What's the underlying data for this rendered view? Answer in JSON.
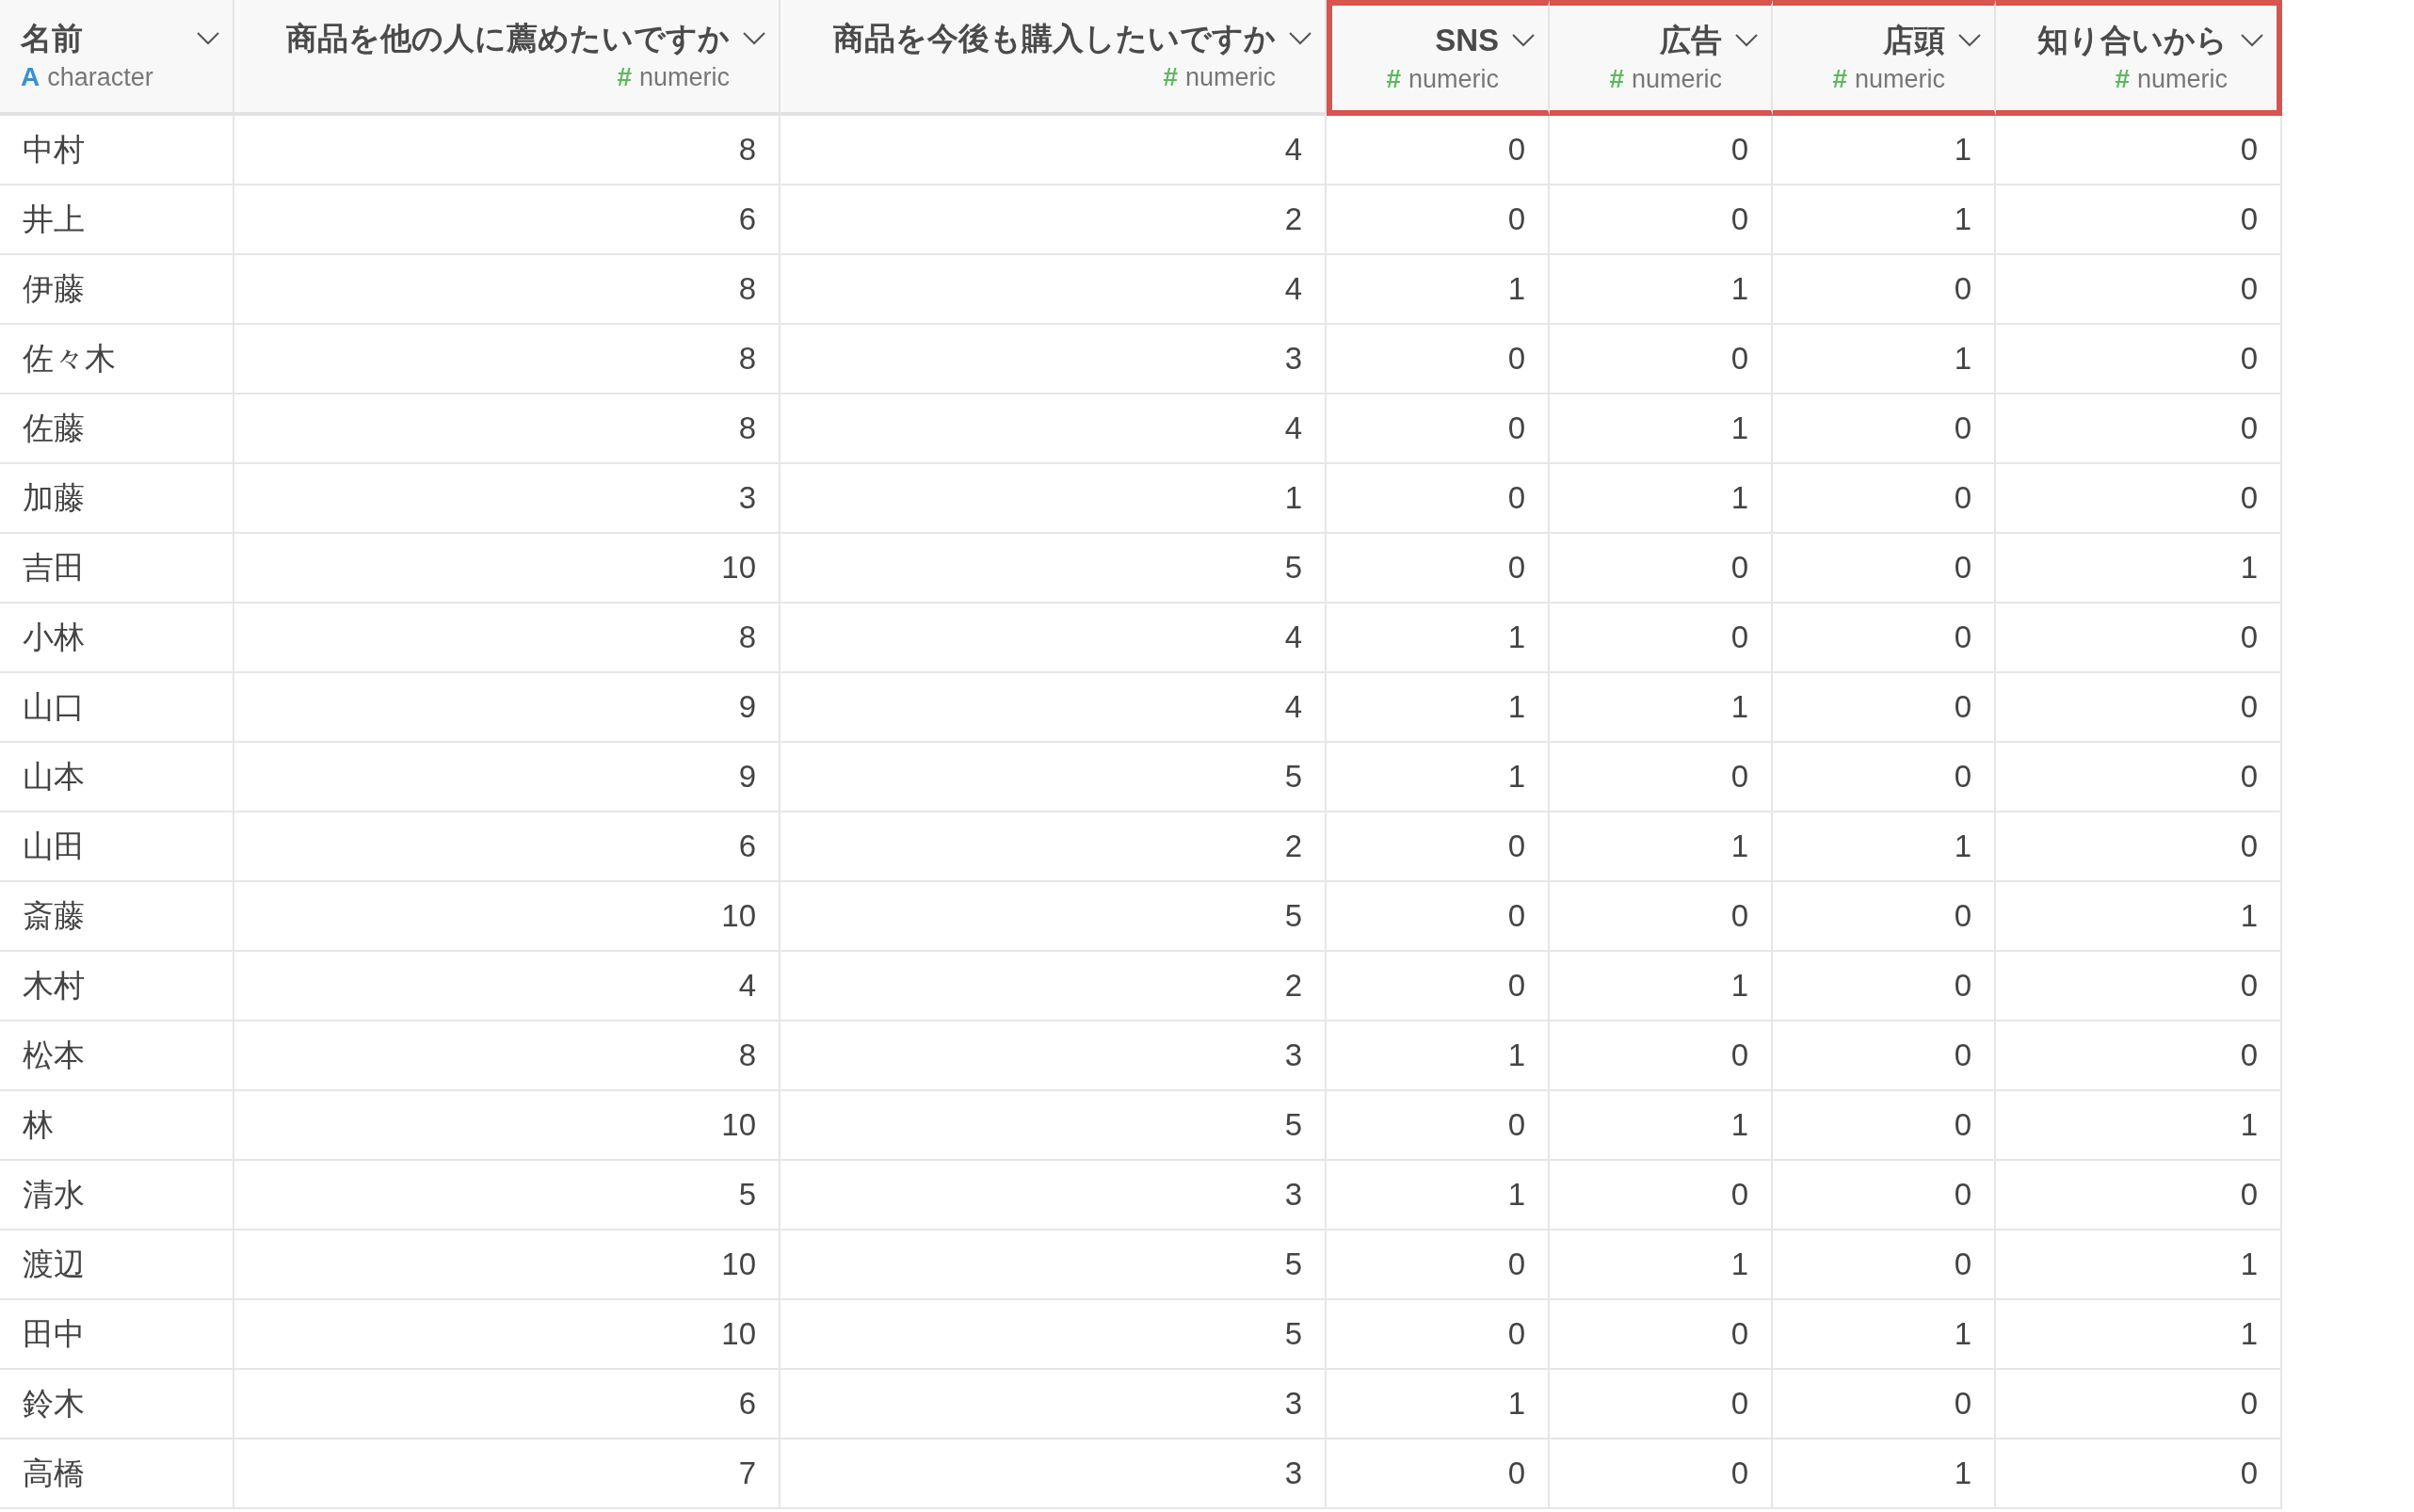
{
  "table": {
    "columns": [
      {
        "title": "名前",
        "type_icon": "A",
        "type": "character",
        "kind": "character",
        "highlighted": false
      },
      {
        "title": "商品を他の人に薦めたいですか",
        "type_icon": "#",
        "type": "numeric",
        "kind": "numeric",
        "highlighted": false
      },
      {
        "title": "商品を今後も購入したいですか",
        "type_icon": "#",
        "type": "numeric",
        "kind": "numeric",
        "highlighted": false
      },
      {
        "title": "SNS",
        "type_icon": "#",
        "type": "numeric",
        "kind": "numeric",
        "highlighted": true
      },
      {
        "title": "広告",
        "type_icon": "#",
        "type": "numeric",
        "kind": "numeric",
        "highlighted": true
      },
      {
        "title": "店頭",
        "type_icon": "#",
        "type": "numeric",
        "kind": "numeric",
        "highlighted": true
      },
      {
        "title": "知り合いから",
        "type_icon": "#",
        "type": "numeric",
        "kind": "numeric",
        "highlighted": true
      }
    ],
    "rows": [
      [
        "中村",
        "8",
        "4",
        "0",
        "0",
        "1",
        "0"
      ],
      [
        "井上",
        "6",
        "2",
        "0",
        "0",
        "1",
        "0"
      ],
      [
        "伊藤",
        "8",
        "4",
        "1",
        "1",
        "0",
        "0"
      ],
      [
        "佐々木",
        "8",
        "3",
        "0",
        "0",
        "1",
        "0"
      ],
      [
        "佐藤",
        "8",
        "4",
        "0",
        "1",
        "0",
        "0"
      ],
      [
        "加藤",
        "3",
        "1",
        "0",
        "1",
        "0",
        "0"
      ],
      [
        "吉田",
        "10",
        "5",
        "0",
        "0",
        "0",
        "1"
      ],
      [
        "小林",
        "8",
        "4",
        "1",
        "0",
        "0",
        "0"
      ],
      [
        "山口",
        "9",
        "4",
        "1",
        "1",
        "0",
        "0"
      ],
      [
        "山本",
        "9",
        "5",
        "1",
        "0",
        "0",
        "0"
      ],
      [
        "山田",
        "6",
        "2",
        "0",
        "1",
        "1",
        "0"
      ],
      [
        "斎藤",
        "10",
        "5",
        "0",
        "0",
        "0",
        "1"
      ],
      [
        "木村",
        "4",
        "2",
        "0",
        "1",
        "0",
        "0"
      ],
      [
        "松本",
        "8",
        "3",
        "1",
        "0",
        "0",
        "0"
      ],
      [
        "林",
        "10",
        "5",
        "0",
        "1",
        "0",
        "1"
      ],
      [
        "清水",
        "5",
        "3",
        "1",
        "0",
        "0",
        "0"
      ],
      [
        "渡辺",
        "10",
        "5",
        "0",
        "1",
        "0",
        "1"
      ],
      [
        "田中",
        "10",
        "5",
        "0",
        "0",
        "1",
        "1"
      ],
      [
        "鈴木",
        "6",
        "3",
        "1",
        "0",
        "0",
        "0"
      ],
      [
        "高橋",
        "7",
        "3",
        "0",
        "0",
        "1",
        "0"
      ]
    ]
  }
}
